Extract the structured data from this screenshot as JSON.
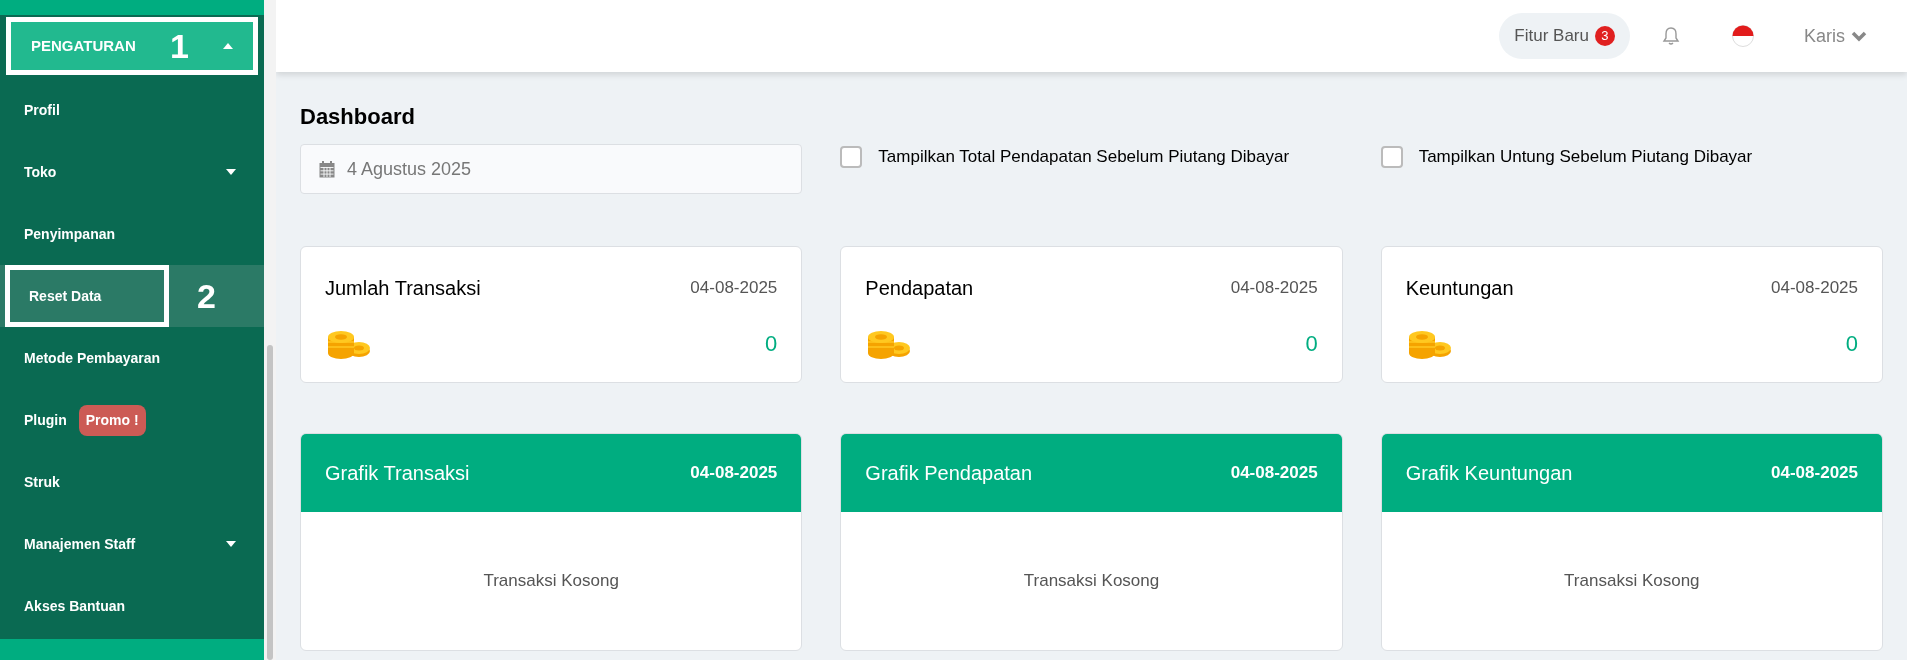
{
  "sidebar": {
    "section": {
      "label": "PENGATURAN",
      "expanded": true,
      "annotation": "1"
    },
    "items": [
      {
        "label": "Profil",
        "selected": false
      },
      {
        "label": "Toko",
        "selected": false,
        "expanded": false
      },
      {
        "label": "Penyimpanan",
        "selected": false
      },
      {
        "label": "Reset Data",
        "selected": true,
        "annotation": "2"
      },
      {
        "label": "Metode Pembayaran",
        "selected": false
      },
      {
        "label": "Plugin",
        "selected": false,
        "badge": "Promo !"
      },
      {
        "label": "Struk",
        "selected": false
      },
      {
        "label": "Manajemen Staff",
        "selected": false,
        "expanded": false
      },
      {
        "label": "Akses Bantuan",
        "selected": false
      }
    ]
  },
  "header": {
    "new_features": {
      "label": "Fitur Baru",
      "count": "3"
    },
    "user": "Karis"
  },
  "page": {
    "title": "Dashboard",
    "date_field": {
      "value": "4 Agustus 2025"
    },
    "options": [
      {
        "label": "Tampilkan Total Pendapatan Sebelum Piutang Dibayar",
        "checked": false
      },
      {
        "label": "Tampilkan Untung Sebelum Piutang Dibayar",
        "checked": false
      }
    ],
    "stats": [
      {
        "title": "Jumlah Transaksi",
        "date": "04-08-2025",
        "value": "0"
      },
      {
        "title": "Pendapatan",
        "date": "04-08-2025",
        "value": "0"
      },
      {
        "title": "Keuntungan",
        "date": "04-08-2025",
        "value": "0"
      }
    ],
    "charts": [
      {
        "title": "Grafik Transaksi",
        "date": "04-08-2025",
        "empty_text": "Transaksi Kosong"
      },
      {
        "title": "Grafik Pendapatan",
        "date": "04-08-2025",
        "empty_text": "Transaksi Kosong"
      },
      {
        "title": "Grafik Keuntungan",
        "date": "04-08-2025",
        "empty_text": "Transaksi Kosong"
      }
    ]
  }
}
